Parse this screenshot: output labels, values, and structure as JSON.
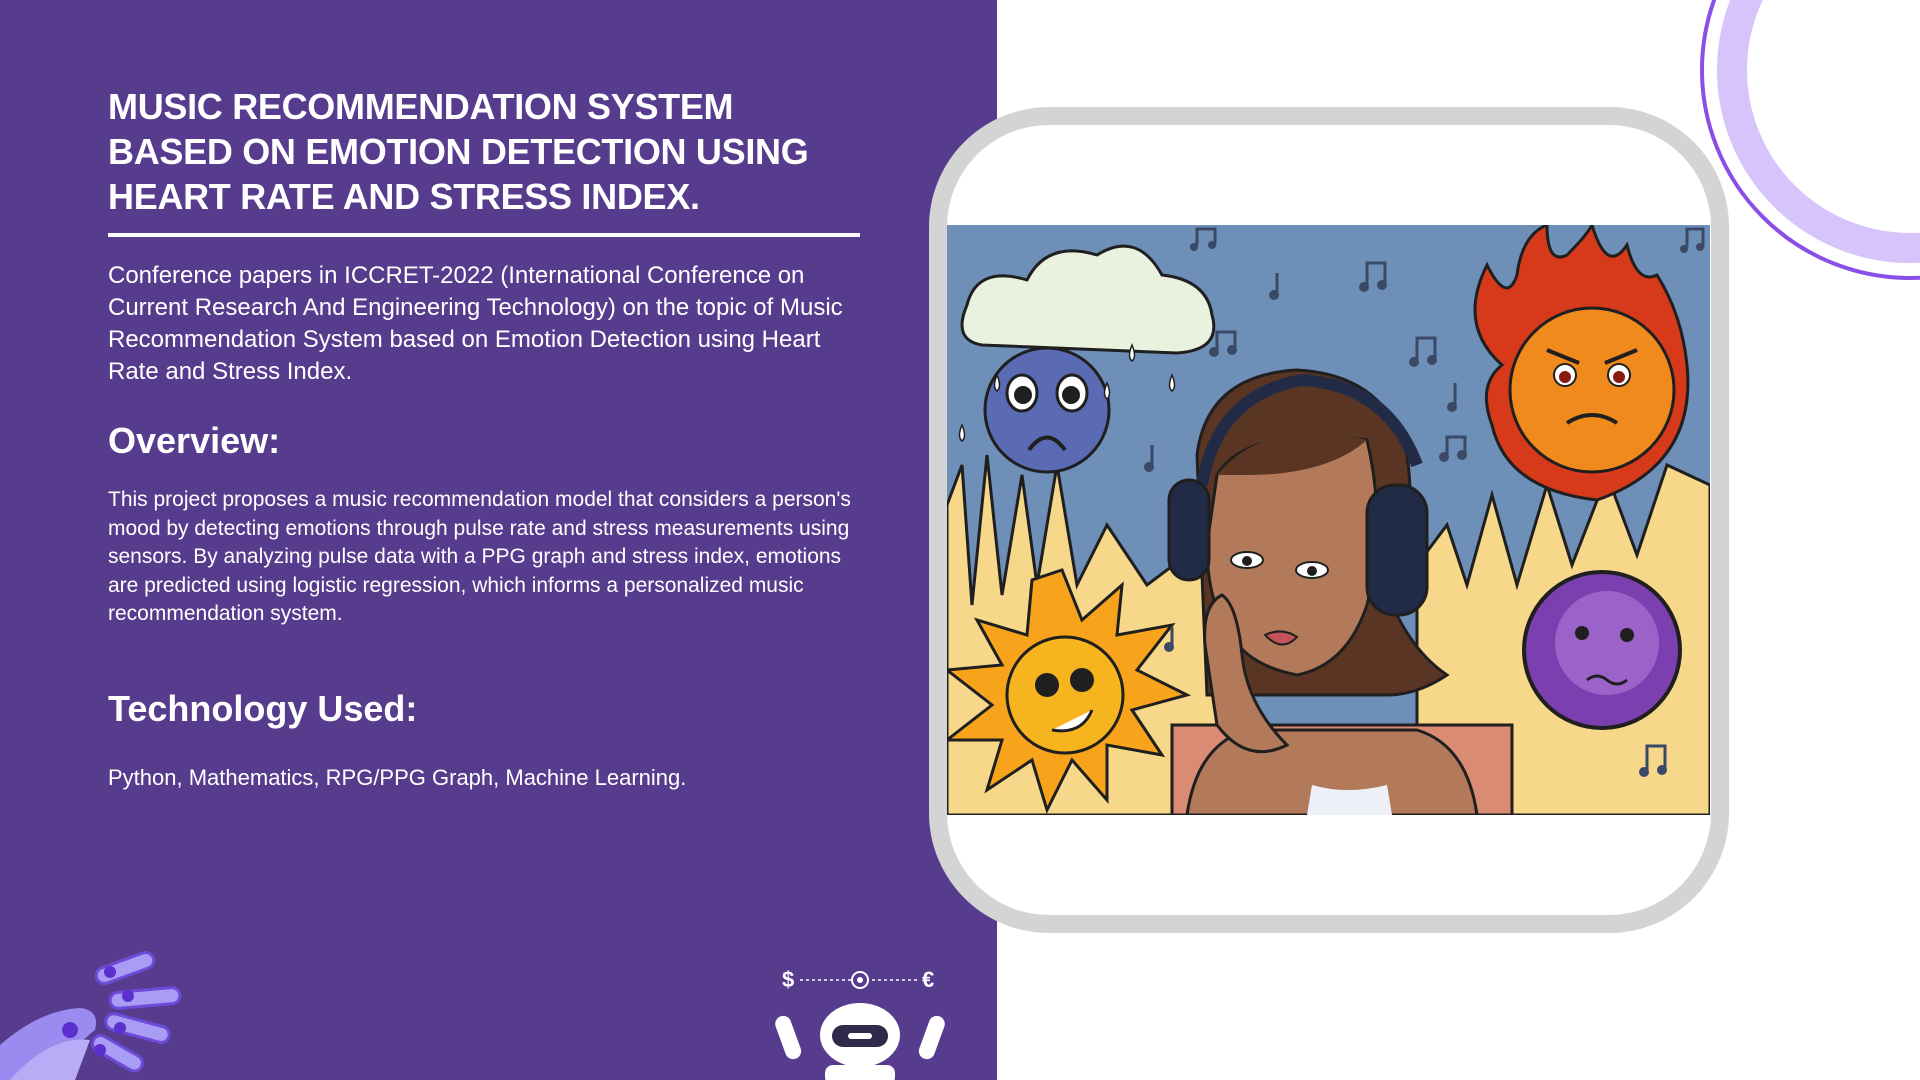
{
  "slide": {
    "title_lines": [
      "MUSIC RECOMMENDATION SYSTEM",
      "BASED ON EMOTION DETECTION USING",
      "HEART RATE AND STRESS INDEX."
    ],
    "intro": "Conference papers in ICCRET-2022 (International Conference on Current Research And Engineering Technology) on the topic of Music Recommendation System based on Emotion Detection using Heart Rate and Stress Index.",
    "overview_heading": "Overview:",
    "overview_text": "This project proposes a music recommendation model that considers a person's mood by detecting emotions through pulse rate and stress measurements using sensors. By analyzing pulse data with a PPG graph and stress index, emotions are predicted using logistic regression, which informs a personalized music recommendation system.",
    "tech_heading": "Technology Used:",
    "tech_text": "Python, Mathematics, RPG/PPG Graph, Machine Learning."
  },
  "robot_badge": {
    "left_symbol": "$",
    "right_symbol": "€"
  },
  "colors": {
    "panel_bg": "#573c8e",
    "frame_border": "#d4d4d4",
    "accent_purple": "#8a4fe6",
    "light_purple": "#d6c4fb"
  },
  "icons": [
    "robot-hand-icon",
    "robot-icon",
    "gear-icon",
    "music-note-icon"
  ]
}
